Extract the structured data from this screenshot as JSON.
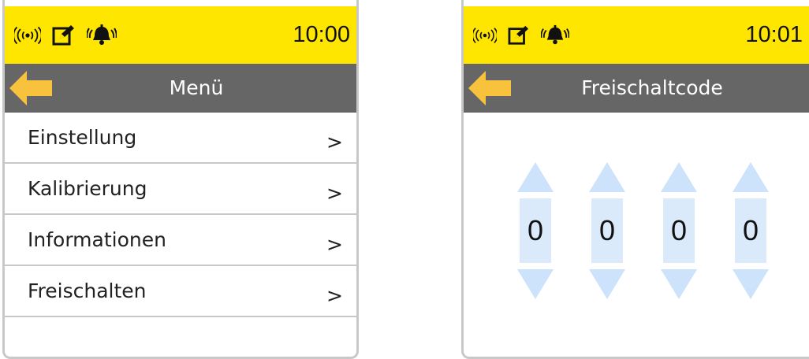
{
  "colors": {
    "status_bar": "#ffe600",
    "title_bar": "#666666",
    "back_arrow": "#f9c23c",
    "digit_spinner": "#cce3fb",
    "divider": "#c8c8c8"
  },
  "status_icons": [
    "wireless-signal-icon",
    "edit-note-icon",
    "alarm-bell-icon"
  ],
  "menu_screen": {
    "clock": "10:00",
    "title": "Menü",
    "items": [
      {
        "label": "Einstellung",
        "chevron": ">"
      },
      {
        "label": "Kalibrierung",
        "chevron": ">"
      },
      {
        "label": "Informationen",
        "chevron": ">"
      },
      {
        "label": "Freischalten",
        "chevron": ">"
      }
    ]
  },
  "code_screen": {
    "clock": "10:01",
    "title": "Freischaltcode",
    "digits": [
      "0",
      "0",
      "0",
      "0"
    ]
  }
}
